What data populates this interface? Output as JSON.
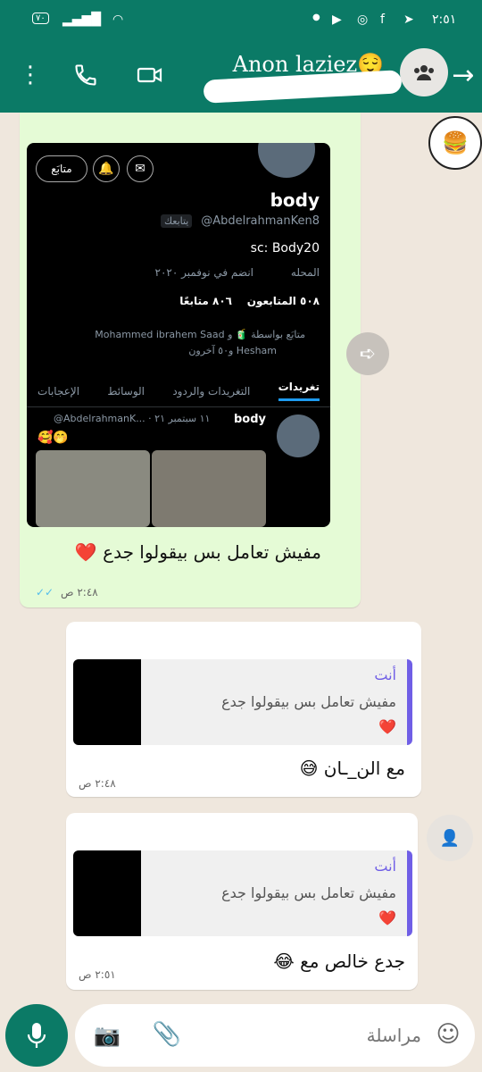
{
  "status": {
    "time": "٢:٥١",
    "battery": "٧٠"
  },
  "header": {
    "contact_name": "Anon laziez😌"
  },
  "tweet_card": {
    "name": "body",
    "handle": "@AbdelrahmanKen8",
    "follows_you": "يتابعك",
    "follow_button": "متابَع",
    "bio": "sc: Body20",
    "location": "المحله",
    "joined": "انضم في نوفمبر ٢٠٢٠",
    "followers": "٥٠٨ المتابعون",
    "following": "٨٠٦ متابعًا",
    "followed_by_line1": "متابَع بواسطة 🧃 و Mohammed ibrahem Saad",
    "followed_by_line2": "Hesham و٥٠ آخرون",
    "tabs": [
      "تغريدات",
      "التغريدات والردود",
      "الوسائط",
      "الإعجابات"
    ],
    "tweet_author": "body",
    "tweet_meta": "@AbdelrahmanK... · ١١ سبتمبر ٢١",
    "tweet_emojis": "🥰🤭"
  },
  "msg1": {
    "text": "مفيش تعامل بس بيقولوا جدع ❤️",
    "time": "٢:٤٨ ص"
  },
  "msg2": {
    "quote_author": "أنت",
    "quote_text": "مفيش تعامل بس بيقولوا جدع",
    "quote_heart": "❤️",
    "text": "مع الن_ـان 😅",
    "time": "٢:٤٨ ص"
  },
  "msg3": {
    "quote_author": "أنت",
    "quote_text": "مفيش تعامل بس بيقولوا جدع",
    "quote_heart": "❤️",
    "text": "جدع خالص مع 😂",
    "time": "٢:٥١ ص"
  },
  "input": {
    "placeholder": "مراسلة"
  },
  "colors": {
    "brand": "#0b7a66",
    "out_bubble": "#e5fbd6",
    "quote_bar": "#6f5ee6",
    "tick": "#53bdeb"
  }
}
